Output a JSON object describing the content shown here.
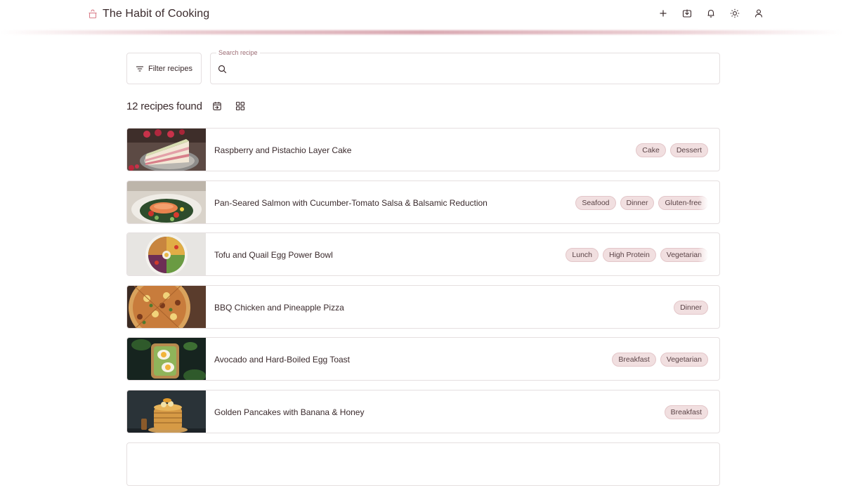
{
  "header": {
    "title": "The Habit of Cooking",
    "icons": [
      "cooking-pot-icon",
      "plus-icon",
      "import-icon",
      "bell-icon",
      "sun-icon",
      "user-icon"
    ]
  },
  "toolbar": {
    "filter_label": "Filter recipes",
    "search_legend": "Search recipe",
    "search_value": ""
  },
  "results": {
    "count_label": "12 recipes found"
  },
  "colors": {
    "accent": "#d97f8a",
    "tag_bg": "#f1dfe0",
    "tag_border": "#e3c6c9",
    "text": "#3a2a2c",
    "border": "#e5dfe0"
  },
  "recipes": [
    {
      "title": "Raspberry and Pistachio Layer Cake",
      "tags": [
        "Cake",
        "Dessert"
      ]
    },
    {
      "title": "Pan-Seared Salmon with Cucumber-Tomato Salsa & Balsamic Reduction",
      "tags": [
        "Seafood",
        "Dinner",
        "Gluten-free"
      ]
    },
    {
      "title": "Tofu and Quail Egg Power Bowl",
      "tags": [
        "Lunch",
        "High Protein",
        "Vegetarian"
      ]
    },
    {
      "title": "BBQ Chicken and Pineapple Pizza",
      "tags": [
        "Dinner"
      ]
    },
    {
      "title": "Avocado and Hard-Boiled Egg Toast",
      "tags": [
        "Breakfast",
        "Vegetarian"
      ]
    },
    {
      "title": "Golden Pancakes with Banana & Honey",
      "tags": [
        "Breakfast"
      ]
    }
  ]
}
